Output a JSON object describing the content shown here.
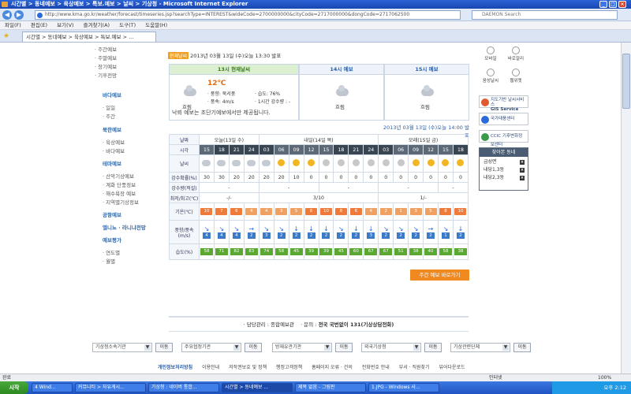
{
  "window": {
    "title": "시간별 > 동네예보 > 육상예보 > 특보.예보 > 날씨 > 기상청 - Microsoft Internet Explorer",
    "url": "http://www.kma.go.kr/weather/forecast/timeseries.jsp?searchType=INTEREST&wideCode=2700000000&cityCode=2717000000&dongCode=2717062500",
    "search_placeholder": "DAEMON Search"
  },
  "menu": [
    "파일(F)",
    "편집(E)",
    "보기(V)",
    "즐겨찾기(A)",
    "도구(T)",
    "도움말(H)"
  ],
  "tabs": [
    "시간별 > 동네예보 > 육상예보 > 특보.예보 > ..."
  ],
  "leftnav": [
    {
      "type": "item",
      "label": "· 주간예보"
    },
    {
      "type": "item",
      "label": "· 주말예보"
    },
    {
      "type": "item",
      "label": "· 장기예보"
    },
    {
      "type": "item",
      "label": "· 기후전망"
    },
    {
      "type": "section",
      "label": "바다예보"
    },
    {
      "type": "item",
      "label": "· 일일"
    },
    {
      "type": "item",
      "label": "· 주간"
    },
    {
      "type": "section",
      "label": "북한예보"
    },
    {
      "type": "item",
      "label": "· 육상예보"
    },
    {
      "type": "item",
      "label": "· 바다예보"
    },
    {
      "type": "section",
      "label": "테마예보"
    },
    {
      "type": "item",
      "label": "· 산악기상예보"
    },
    {
      "type": "item",
      "label": "· 계화 단풍정보"
    },
    {
      "type": "item",
      "label": "· 해수욕장 예보"
    },
    {
      "type": "item",
      "label": "· 지역별기상정보"
    },
    {
      "type": "section",
      "label": "공항예보"
    },
    {
      "type": "section",
      "label": "엘니뇨 · 라니냐전망"
    },
    {
      "type": "section",
      "label": "예보평가"
    },
    {
      "type": "item",
      "label": "· 연도별"
    },
    {
      "type": "item",
      "label": "· 월별"
    }
  ],
  "current": {
    "badge": "현재날씨",
    "header": "2013년 03월 13일 (수)오늘 13:30 발표",
    "box1_title": "13시 현재날씨",
    "box1_label": "흐림",
    "box1_temp": "12℃",
    "box1_wind_dir": "· 풍향: 북서풍",
    "box1_humidity": "· 습도: 76%",
    "box1_wind_speed": "· 풍속: 4m/s",
    "box1_rain": "· 1시간 강수량 : -",
    "box2_title": "14시 예보",
    "box2_label": "흐림",
    "box3_title": "15시 예보",
    "box3_label": "흐림",
    "note": "낙뢰 예보는 초단기예보에서만 제공됩니다.",
    "announce": "2013년 03월 13일 (수)오늘 14:00 발표"
  },
  "grid": {
    "day_label": "날짜",
    "days": [
      "오늘(13일 수)",
      "내일(14일 목)",
      "모레(15일 금)"
    ],
    "time_label": "시각",
    "times": [
      "15",
      "18",
      "21",
      "24",
      "03",
      "06",
      "09",
      "12",
      "15",
      "18",
      "21",
      "24",
      "03",
      "06",
      "09",
      "12",
      "15",
      "18"
    ],
    "weather_label": "날씨",
    "weather": [
      "cloud",
      "cloud",
      "cloud",
      "cloud",
      "cloud",
      "sun",
      "sun",
      "sun",
      "moon",
      "moon",
      "moon",
      "moon",
      "moon",
      "moon",
      "sun",
      "sun",
      "sun",
      "sun"
    ],
    "pop_label": "강수확률(%)",
    "pop": [
      "30",
      "30",
      "20",
      "20",
      "20",
      "20",
      "10",
      "0",
      "0",
      "0",
      "0",
      "0",
      "0",
      "0",
      "0",
      "0",
      "0",
      "0"
    ],
    "precip_label": "강수량(적설)",
    "precip": [
      "-",
      "-",
      "-",
      "-",
      "-"
    ],
    "minmax_label": "최저/최고(℃)",
    "minmax": [
      "-/-",
      "3/10",
      "1/-"
    ],
    "temp_label": "기온(℃)",
    "temps": [
      "10",
      "7",
      "6",
      "4",
      "4",
      "3",
      "5",
      "8",
      "10",
      "8",
      "6",
      "4",
      "2",
      "1",
      "3",
      "5",
      "8",
      "10"
    ],
    "wind_label": "풍향/풍속(m/s)",
    "wind": [
      "4",
      "4",
      "4",
      "2",
      "3",
      "2",
      "2",
      "2",
      "2",
      "2",
      "2",
      "3",
      "2",
      "2",
      "2",
      "2",
      "1",
      "2"
    ],
    "hum_label": "습도(%)",
    "humidity": [
      "58",
      "71",
      "82",
      "83",
      "74",
      "58",
      "45",
      "39",
      "39",
      "45",
      "60",
      "67",
      "67",
      "51",
      "38",
      "40",
      "58",
      "38"
    ]
  },
  "weekly_button": "주간 예보 바로가기",
  "contact": {
    "prefix": "· 담당관리 : 종합예보관",
    "middle": "· 문의 : ",
    "phone": "전국 국번없이 131(기상상담전화)"
  },
  "footer_selects": [
    {
      "label": "기상청소속기관",
      "btn": "이동"
    },
    {
      "label": "주요협정기관",
      "btn": "이동"
    },
    {
      "label": "방재유관기관",
      "btn": "이동"
    },
    {
      "label": "외국기상청",
      "btn": "이동"
    },
    {
      "label": "기상관련단체",
      "btn": "이동"
    }
  ],
  "footer_links": [
    "개인정보처리방침",
    "이용안내",
    "저작권보호 및 정책",
    "행정고객정책",
    "홈페이지 오류 · 건의",
    "전화번호 안내",
    "부서 · 직원찾기",
    "뷰어다운로드"
  ],
  "rightbar": {
    "icons": [
      "모바일",
      "바로알리",
      "음성날씨",
      "웹위젯"
    ],
    "banner1_line1": "지도기반 날씨서비스",
    "banner1_line2": "GIS Service",
    "banner2": "국가태풍센터",
    "banner3_line1": "CCIC 기후변화정보센터",
    "search_title": "찾아본 동네",
    "search_items": [
      "금성면",
      "내당1,3동",
      "내당2,3동"
    ]
  },
  "status": {
    "left": "완료",
    "zone": "인터넷",
    "zoom": "100%"
  },
  "taskbar": {
    "start": "시작",
    "items": [
      "4 Wind...",
      "커뮤니티 > 자유게시...",
      "기상청 : 네이버 통합...",
      "시간별 > 동네예보 ...",
      "제목 없음 - 그림판",
      "1.JPG - Windows 사..."
    ],
    "clock": "오후 2:12"
  }
}
